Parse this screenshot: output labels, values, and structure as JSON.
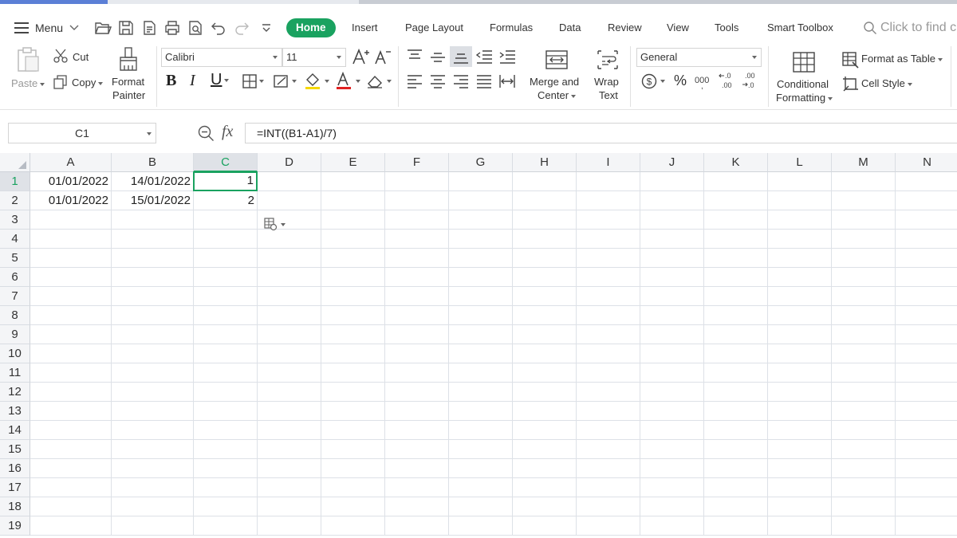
{
  "menubar": {
    "menu_label": "Menu",
    "tabs": [
      {
        "label": "Home",
        "active": true
      },
      {
        "label": "Insert"
      },
      {
        "label": "Page Layout"
      },
      {
        "label": "Formulas"
      },
      {
        "label": "Data"
      },
      {
        "label": "Review"
      },
      {
        "label": "View"
      },
      {
        "label": "Tools"
      },
      {
        "label": "Smart Toolbox"
      }
    ],
    "search_placeholder": "Click to find c"
  },
  "ribbon": {
    "paste_label": "Paste",
    "cut_label": "Cut",
    "copy_label": "Copy",
    "format_painter_l1": "Format",
    "format_painter_l2": "Painter",
    "font_name": "Calibri",
    "font_size": "11",
    "merge_l1": "Merge and",
    "merge_l2": "Center",
    "wrap_l1": "Wrap",
    "wrap_l2": "Text",
    "number_format": "General",
    "conditional_l1": "Conditional",
    "conditional_l2": "Formatting",
    "format_as_table": "Format as Table",
    "cell_style": "Cell Style",
    "accent_color": "#1aa260"
  },
  "formula_bar": {
    "name_box": "C1",
    "formula": "=INT((B1-A1)/7)"
  },
  "sheet": {
    "columns": [
      "A",
      "B",
      "C",
      "D",
      "E",
      "F",
      "G",
      "H",
      "I",
      "J",
      "K",
      "L",
      "M",
      "N"
    ],
    "rows": [
      "1",
      "2",
      "3",
      "4",
      "5",
      "6",
      "7",
      "8",
      "9",
      "10",
      "11",
      "12",
      "13",
      "14",
      "15",
      "16",
      "17",
      "18",
      "19"
    ],
    "selected_column": "C",
    "selected_row": "1",
    "cells": [
      {
        "ref": "A1",
        "value": "01/01/2022"
      },
      {
        "ref": "B1",
        "value": "14/01/2022"
      },
      {
        "ref": "C1",
        "value": "1"
      },
      {
        "ref": "A2",
        "value": "01/01/2022"
      },
      {
        "ref": "B2",
        "value": "15/01/2022"
      },
      {
        "ref": "C2",
        "value": "2"
      }
    ]
  }
}
